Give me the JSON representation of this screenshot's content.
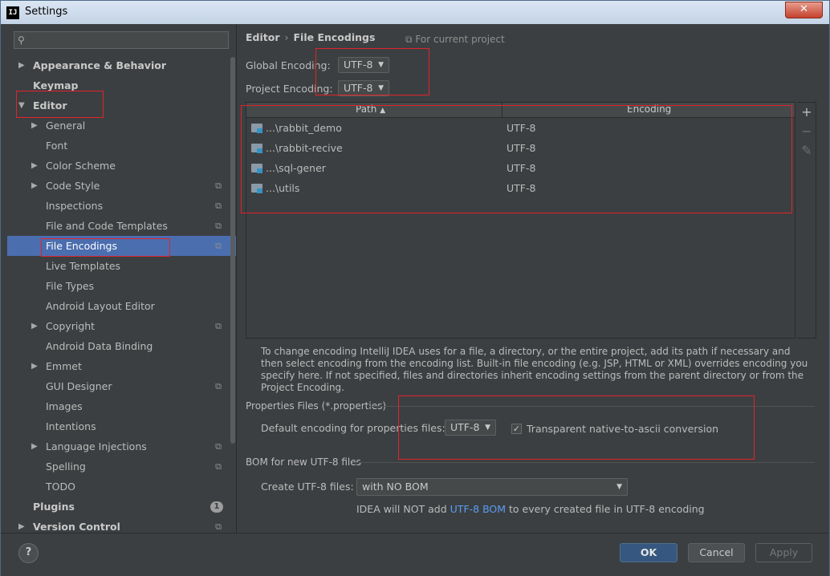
{
  "window": {
    "title": "Settings",
    "app_icon": "IJ",
    "close_symbol": "✕"
  },
  "sidebar": {
    "search_placeholder": "",
    "items": [
      {
        "label": "Appearance & Behavior",
        "level": 0,
        "arrow": "▶",
        "bold": true
      },
      {
        "label": "Keymap",
        "level": 0,
        "arrow": "",
        "bold": true
      },
      {
        "label": "Editor",
        "level": 0,
        "arrow": "▼",
        "bold": true
      },
      {
        "label": "General",
        "level": 1,
        "arrow": "▶"
      },
      {
        "label": "Font",
        "level": 1,
        "arrow": ""
      },
      {
        "label": "Color Scheme",
        "level": 1,
        "arrow": "▶"
      },
      {
        "label": "Code Style",
        "level": 1,
        "arrow": "▶",
        "copy": true
      },
      {
        "label": "Inspections",
        "level": 1,
        "arrow": "",
        "copy": true
      },
      {
        "label": "File and Code Templates",
        "level": 1,
        "arrow": "",
        "copy": true
      },
      {
        "label": "File Encodings",
        "level": 1,
        "arrow": "",
        "copy": true,
        "selected": true
      },
      {
        "label": "Live Templates",
        "level": 1,
        "arrow": ""
      },
      {
        "label": "File Types",
        "level": 1,
        "arrow": ""
      },
      {
        "label": "Android Layout Editor",
        "level": 1,
        "arrow": ""
      },
      {
        "label": "Copyright",
        "level": 1,
        "arrow": "▶",
        "copy": true
      },
      {
        "label": "Android Data Binding",
        "level": 1,
        "arrow": ""
      },
      {
        "label": "Emmet",
        "level": 1,
        "arrow": "▶"
      },
      {
        "label": "GUI Designer",
        "level": 1,
        "arrow": "",
        "copy": true
      },
      {
        "label": "Images",
        "level": 1,
        "arrow": ""
      },
      {
        "label": "Intentions",
        "level": 1,
        "arrow": ""
      },
      {
        "label": "Language Injections",
        "level": 1,
        "arrow": "▶",
        "copy": true
      },
      {
        "label": "Spelling",
        "level": 1,
        "arrow": "",
        "copy": true
      },
      {
        "label": "TODO",
        "level": 1,
        "arrow": ""
      },
      {
        "label": "Plugins",
        "level": 0,
        "arrow": "",
        "bold": true,
        "badge": "1"
      },
      {
        "label": "Version Control",
        "level": 0,
        "arrow": "▶",
        "bold": true,
        "copy": true
      }
    ]
  },
  "content": {
    "breadcrumb": {
      "parent": "Editor",
      "separator": "›",
      "current": "File Encodings"
    },
    "for_project": "For current project",
    "global_encoding": {
      "label": "Global Encoding:",
      "value": "UTF-8"
    },
    "project_encoding": {
      "label": "Project Encoding:",
      "value": "UTF-8"
    },
    "table": {
      "columns": {
        "path": "Path",
        "encoding": "Encoding"
      },
      "rows": [
        {
          "path": "...\\rabbit_demo",
          "encoding": "UTF-8"
        },
        {
          "path": "...\\rabbit-recive",
          "encoding": "UTF-8"
        },
        {
          "path": "...\\sql-gener",
          "encoding": "UTF-8"
        },
        {
          "path": "...\\utils",
          "encoding": "UTF-8"
        }
      ],
      "tools": {
        "add": "+",
        "remove": "−",
        "edit": "✎"
      }
    },
    "description": "To change encoding IntelliJ IDEA uses for a file, a directory, or the entire project, add its path if necessary and then select encoding from the encoding list. Built-in file encoding (e.g. JSP, HTML or XML) overrides encoding you specify here. If not specified, files and directories inherit encoding settings from the parent directory or from the Project Encoding.",
    "properties": {
      "section_title": "Properties Files (*.properties)",
      "default_label": "Default encoding for properties files:",
      "default_value": "UTF-8",
      "transparent_label": "Transparent native-to-ascii conversion",
      "transparent_checked": "✓"
    },
    "bom": {
      "section_title": "BOM for new UTF-8 files",
      "create_label": "Create UTF-8 files:",
      "create_value": "with NO BOM",
      "note_prefix": "IDEA will NOT add ",
      "note_link": "UTF-8 BOM",
      "note_suffix": " to every created file in UTF-8 encoding"
    }
  },
  "footer": {
    "help": "?",
    "ok": "OK",
    "cancel": "Cancel",
    "apply": "Apply"
  },
  "colors": {
    "background": "#3c3f41",
    "selection": "#4b6eaf",
    "ok_button": "#365880",
    "link": "#589df6",
    "annotation_red": "#e0242b"
  }
}
